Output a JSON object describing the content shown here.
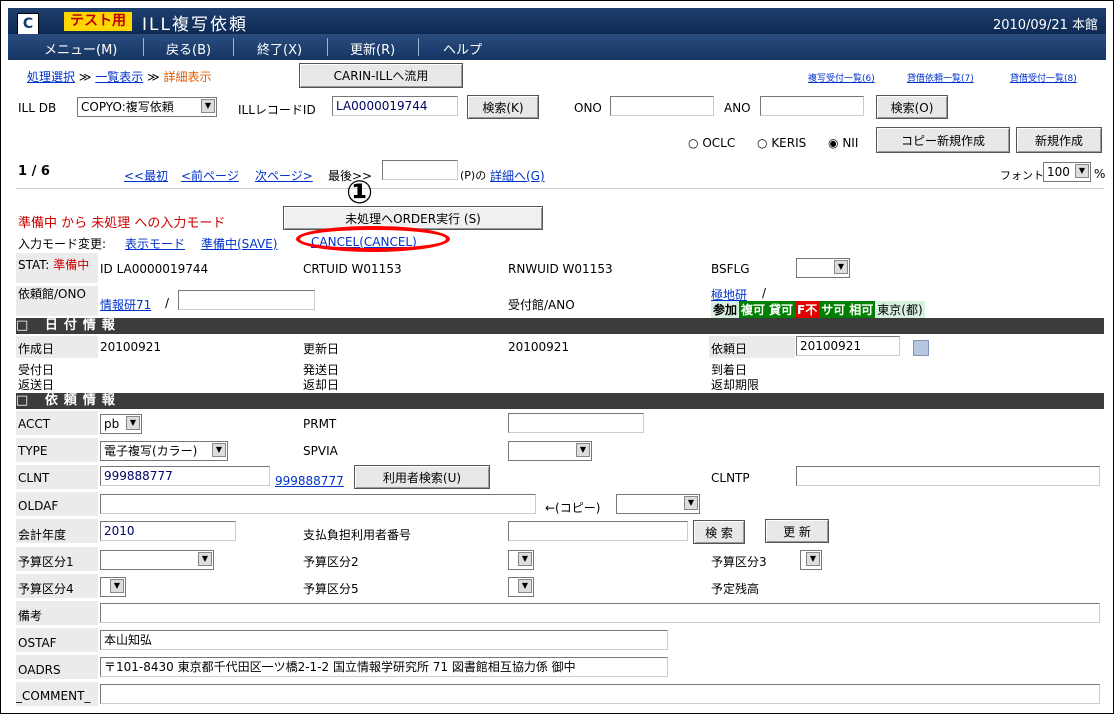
{
  "title": {
    "tag": "テスト用",
    "name": "ILL複写依頼",
    "date": "2010/09/21 本館"
  },
  "menu": [
    "メニュー(M)",
    "戻る(B)",
    "終了(X)",
    "更新(R)",
    "ヘルプ"
  ],
  "breadcrumb": {
    "step1": "処理選択",
    "sep": "≫",
    "step2": "一覧表示",
    "step3": "詳細表示"
  },
  "carin_button": "CARIN-ILLへ流用",
  "top_links": [
    "複写受付一覧(6)",
    "貸借依頼一覧(7)",
    "貸借受付一覧(8)"
  ],
  "search": {
    "illdb_label": "ILL DB",
    "illdb_value": "COPYO:複写依頼",
    "recid_label": "ILLレコードID",
    "recid_value": "LA0000019744",
    "search_k": "検索(K)",
    "ono_label": "ONO",
    "ano_label": "ANO",
    "search_o": "検索(O)"
  },
  "radios": {
    "oclc": "OCLC",
    "keris": "KERIS",
    "nii": "NII"
  },
  "copy_new_button": "コピー新規作成",
  "new_button": "新規作成",
  "paging": {
    "count": "1 / 6",
    "first": "<<最初",
    "prev": "<前ページ",
    "next": "次ページ>",
    "last": "最後>>",
    "p_label": "(P)の",
    "detail": "詳細へ(G)"
  },
  "font": {
    "label": "フォント",
    "value": "100",
    "unit": "%"
  },
  "mode": {
    "line": "準備中 から 未処理 への入力モード",
    "order_button": "未処理へORDER実行 (S)",
    "change_label": "入力モード変更:",
    "display_mode": "表示モード",
    "save_mode": "準備中(SAVE)",
    "cancel_mode": "CANCEL(CANCEL)"
  },
  "callout": "①",
  "stat": {
    "label": "STAT:",
    "value": "準備中",
    "id": "ID LA0000019744",
    "crtuid": "CRTUID W01153",
    "rnwuid": "RNWUID W01153",
    "bsflg": "BSFLG"
  },
  "req": {
    "label": "依頼館/ONO",
    "lib_link": "情報研71",
    "slash": "/",
    "recv_label": "受付館/ANO",
    "kyoku_link": "極地研",
    "kyoku_slash": "/",
    "flags": [
      "参加",
      "複可",
      "貸可",
      "F不",
      "サ可",
      "相可",
      "東京(都)"
    ]
  },
  "sec_date": "日付情報",
  "dates": {
    "created_label": "作成日",
    "created": "20100921",
    "updated_label": "更新日",
    "updated": "20100921",
    "req_label": "依頼日",
    "req_value": "20100921",
    "recv_label": "受付日",
    "sent_label": "発送日",
    "arrive_label": "到着日",
    "return_label": "返送日",
    "returned_label": "返却日",
    "due_label": "返却期限"
  },
  "sec_req": "依頼情報",
  "fields": {
    "acct_label": "ACCT",
    "acct": "pb",
    "prmt_label": "PRMT",
    "type_label": "TYPE",
    "type": "電子複写(カラー)",
    "spvia_label": "SPVIA",
    "clnt_label": "CLNT",
    "clnt": "999888777",
    "clnt_link": "999888777",
    "user_search": "利用者検索(U)",
    "clntp_label": "CLNTP",
    "oldaf_label": "OLDAF",
    "copy_label": "←(コピー)",
    "fy_label": "会計年度",
    "fy": "2010",
    "payer_label": "支払負担利用者番号",
    "search_btn": "検 索",
    "update_btn": "更 新",
    "budget1": "予算区分1",
    "budget2": "予算区分2",
    "budget3": "予算区分3",
    "budget4": "予算区分4",
    "budget5": "予算区分5",
    "remain": "予定残高",
    "memo_label": "備考",
    "ostaf_label": "OSTAF",
    "ostaf": "本山知弘",
    "oadrs_label": "OADRS",
    "oadrs": "〒101-8430 東京都千代田区一ツ橋2-1-2 国立情報学研究所 71 図書館相互協力係 御中",
    "comment_label": "_COMMENT_"
  }
}
